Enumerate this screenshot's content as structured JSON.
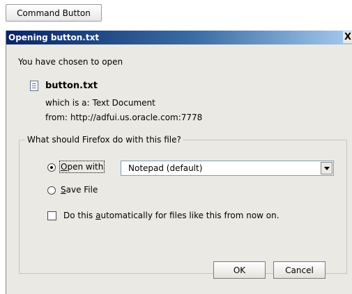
{
  "command_button": {
    "label": "Command Button"
  },
  "dialog": {
    "title": "Opening button.txt",
    "close_glyph": "X",
    "intro": "You have chosen to open",
    "file": {
      "name": "button.txt",
      "type_label": "which is a:",
      "type_value": "Text Document",
      "from_label": "from:",
      "from_value": "http://adfui.us.oracle.com:7778"
    },
    "group": {
      "legend": "What should Firefox do with this file?",
      "open_with": {
        "pre": "",
        "key": "O",
        "post": "pen with",
        "checked": true
      },
      "app_select": {
        "value": "Notepad (default)"
      },
      "save_file": {
        "key": "S",
        "post": "ave File",
        "checked": false
      },
      "auto": {
        "pre": "Do this ",
        "key": "a",
        "post": "utomatically for files like this from now on.",
        "checked": false
      }
    },
    "buttons": {
      "ok": "OK",
      "cancel": "Cancel"
    }
  }
}
